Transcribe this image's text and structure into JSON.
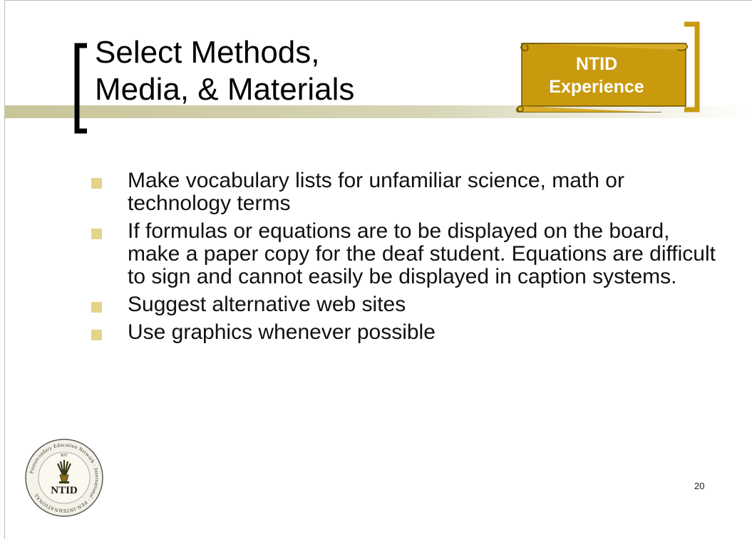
{
  "slide": {
    "title_lines": [
      "Select Methods,",
      "Media, & Materials"
    ],
    "badge_lines": [
      "NTID",
      "Experience"
    ],
    "bullets": [
      "Make vocabulary lists for unfamiliar science, math or technology terms",
      "If formulas or equations are to be displayed on the board, make a paper copy for the deaf student.  Equations are difficult to sign and cannot easily be displayed in caption systems.",
      "Suggest alternative web sites",
      "Use graphics whenever possible"
    ],
    "logo": {
      "center_text": "NTID",
      "top_text": "RIT",
      "ring_text": "Postsecondary Education Network · International · PEN-INTERNATIONAL"
    },
    "page_number": "20"
  },
  "colors": {
    "accent_gold": "#c99a0e",
    "bullet_marker": "#e3d489",
    "title_rule": "#c8c59a"
  }
}
